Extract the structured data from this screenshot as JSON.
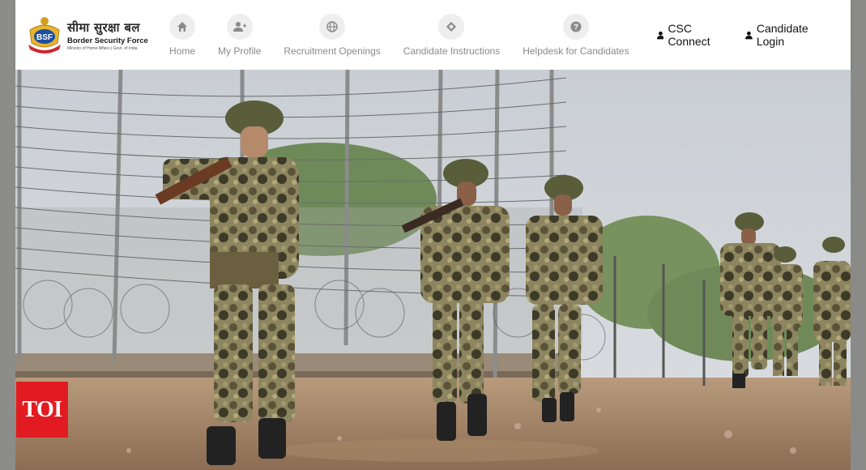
{
  "brand": {
    "hindi_name": "सीमा सुरक्षा बल",
    "english_name": "Border Security Force",
    "ministry": "Ministry of Home Affairs | Govt. of India",
    "emblem_text": "BSF"
  },
  "nav": {
    "items": [
      {
        "label": "Home",
        "icon": "home-icon"
      },
      {
        "label": "My Profile",
        "icon": "user-plus-icon"
      },
      {
        "label": "Recruitment Openings",
        "icon": "globe-icon"
      },
      {
        "label": "Candidate Instructions",
        "icon": "compass-icon"
      },
      {
        "label": "Helpdesk for Candidates",
        "icon": "help-circle-icon"
      }
    ],
    "csc_connect": "CSC Connect",
    "candidate_login": "Candidate Login"
  },
  "watermark": {
    "text": "TOI",
    "color": "#e21b22"
  },
  "colors": {
    "navbar_bg": "#ffffff",
    "nav_label": "#8a8a8a",
    "icon_bg": "#eeeeee"
  }
}
